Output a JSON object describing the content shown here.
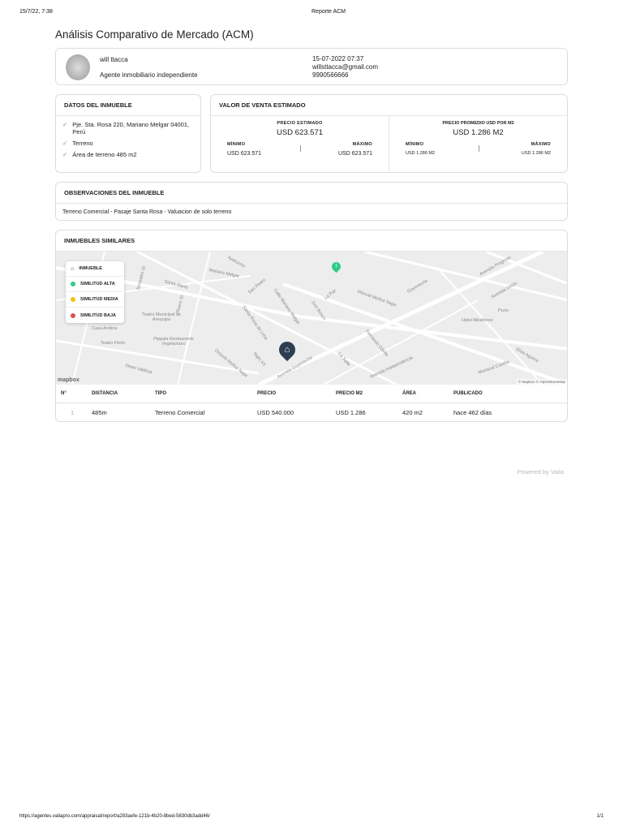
{
  "browser": {
    "datetime": "15/7/22, 7:38",
    "page_title": "Reporte ACM",
    "url": "https://agentes.valiapro.com/appraisal/report/a283aefe-121b-4b20-8bed-5830db3add46/",
    "page_num": "1/1"
  },
  "title": "Análisis Comparativo de Mercado (ACM)",
  "agent": {
    "name": "will ttacca",
    "role": "Agente inmobiliario independiente",
    "date": "15-07-2022 07:37",
    "email": "willsttacca@gmail.com",
    "phone": "9990566666"
  },
  "datos": {
    "heading": "DATOS DEL INMUEBLE",
    "items": [
      "Pje. Sta. Rosa 220, Mariano Melgar 04001, Perú",
      "Terreno",
      "Área de terreno 485 m2"
    ]
  },
  "valor": {
    "heading": "VALOR DE VENTA ESTIMADO",
    "precio": {
      "label": "PRECIO ESTIMADO",
      "value": "USD 623.571",
      "min_label": "MÍNIMO",
      "min": "USD 623.571",
      "max_label": "MÁXIMO",
      "max": "USD 623.571"
    },
    "m2": {
      "label": "PRECIO PROMEDIO USD POR M2",
      "value": "USD 1.286 M2",
      "min_label": "MÍNIMO",
      "min": "USD 1.286 M2",
      "max_label": "MÁXIMO",
      "max": "USD 1.286 M2"
    }
  },
  "obs": {
    "heading": "OBSERVACIONES DEL INMUEBLE",
    "text": "Terreno Comercial - Pasaje Santa Rosa - Valuacion de solo terreno"
  },
  "similares": {
    "heading": "INMUEBLES SIMILARES",
    "legend": [
      {
        "label": "INMUEBLE",
        "icon": "home-icon",
        "color": "#2c3e50"
      },
      {
        "label": "SIMILITUD ALTA",
        "color": "#2ecc8a"
      },
      {
        "label": "SIMILITUD MEDIA",
        "color": "#f0c419"
      },
      {
        "label": "SIMILITUD BAJA",
        "color": "#d9534f"
      }
    ],
    "map_labels": [
      "Mariano Melgar",
      "Santa Marta",
      "San Pedro",
      "Calle Mariano Melgar",
      "Santa Rosa de Lima",
      "Don Bosco",
      "La Paz",
      "Manuel Muñoz Najar",
      "Goyeneche",
      "Avenida Progreso",
      "Avenida Unión",
      "Puno",
      "Hotel Miraflores",
      "Teatro Municipal de Arequipa",
      "Casa Andina",
      "Teatro Fénix",
      "Pippala Restaurante Vegetariano",
      "Siglo XX",
      "Avenida Goyeneche",
      "La Salle",
      "Avenida Independencia",
      "Fernando Dávila",
      "Ayacucho",
      "Jerusalén St",
      "Rivero St",
      "Dean Valdivia",
      "Octavio Muñoz Najar",
      "Elías Aguirre",
      "Mariscal Castilla"
    ],
    "attribution": "© Mapbox © OpenStreetMap",
    "mapbox": "mapbox",
    "marker_num": "1",
    "columns": [
      "N°",
      "DISTANCIA",
      "TIPO",
      "PRECIO",
      "PRECIO M2",
      "ÁREA",
      "PUBLICADO"
    ],
    "rows": [
      [
        "1",
        "485m",
        "Terreno Comercial",
        "USD 540.000",
        "USD 1.286",
        "420 m2",
        "hace 462 días"
      ]
    ]
  },
  "powered": "Powered by Valia"
}
